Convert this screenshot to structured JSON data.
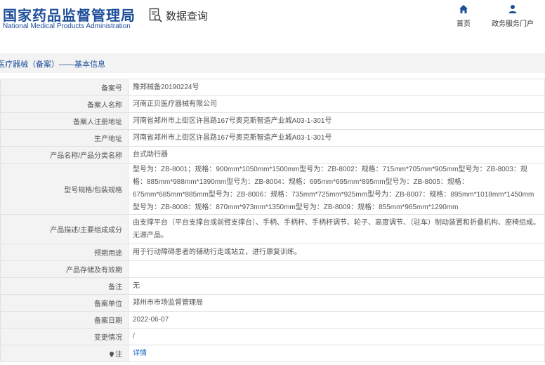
{
  "header": {
    "logo_cn": "国家药品监督管理局",
    "logo_en": "National Medical Products Administration",
    "query_label": "数据查询",
    "nav": [
      {
        "label": "首页",
        "icon": "home-icon"
      },
      {
        "label": "政务服务门户",
        "icon": "user-icon"
      }
    ]
  },
  "breadcrumb": "医疗器械（备案）——基本信息",
  "colors": {
    "brand": "#1e4e9a",
    "label_bg": "#f3f3f3",
    "border": "#e1e1e1",
    "link": "#1e6ac8"
  },
  "rows": [
    {
      "label": "备案号",
      "value": "豫郑械备20190224号"
    },
    {
      "label": "备案人名称",
      "value": "河南正贝医疗器械有限公司"
    },
    {
      "label": "备案人注册地址",
      "value": "河南省郑州市上街区许昌路167号奥克斯智造产业城A03-1-301号"
    },
    {
      "label": "生产地址",
      "value": "河南省郑州市上街区许昌路167号奥克斯智造产业城A03-1-301号"
    },
    {
      "label": "产品名称/产品分类名称",
      "value": "台式助行器"
    },
    {
      "label": "型号规格/包装规格",
      "value": "型号为：ZB-8001；规格：900mm*1050mm*1500mm型号为：ZB-8002：规格：715mm*705mm*905mm型号为：ZB-8003：规格：885mm*988mm*1390mm型号为：ZB-8004：规格：695mm*695mm*895mm型号为：ZB-8005：规格：675mm*685mm*885mm型号为：ZB-8006：规格：735mm*725mm*925mm型号为：ZB-8007：规格：895mm*1018mm*1450mm型号为：ZB-8008：规格：870mm*973mm*1350mm型号为：ZB-8009：规格：855mm*965mm*1290mm"
    },
    {
      "label": "产品描述/主要组成成分",
      "value": "由支撑平台（平台支撑台或前臂支撑台）、手柄、手柄杆、手柄杆调节、轮子、高度调节、（驻车）制动装置和折叠机构、座椅组成。无源产品。"
    },
    {
      "label": "预期用途",
      "value": "用于行动障碍患者的辅助行走或站立，进行康复训练。"
    },
    {
      "label": "产品存储及有效期",
      "value": ""
    },
    {
      "label": "备注",
      "value": "无"
    },
    {
      "label": "备案单位",
      "value": "郑州市市场监督管理局"
    },
    {
      "label": "备案日期",
      "value": "2022-06-07"
    },
    {
      "label": "变更情况",
      "value": "/"
    },
    {
      "label": "注",
      "value": "详情"
    }
  ]
}
